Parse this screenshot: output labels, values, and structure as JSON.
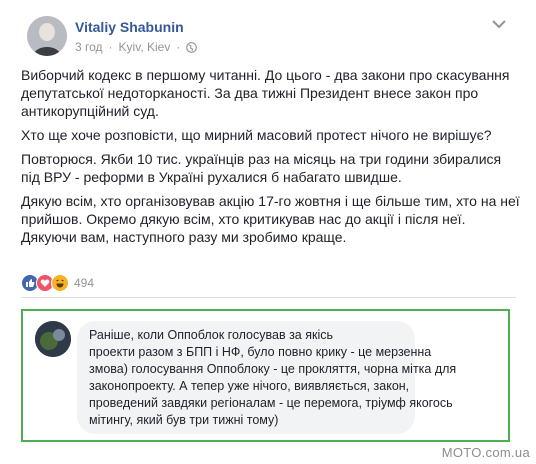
{
  "post": {
    "author": "Vitaliy Shabunin",
    "time": "3 год",
    "location": "Kyiv, Kiev",
    "separator": "·",
    "paragraphs": [
      "Виборчий кодекс в першому читанні. До цього - два закони про скасування депутатської недоторканості. За два тижні Президент внесе закон про антикорупційний суд.",
      "Хто ще хоче розповісти, що мирний масовий протест нічого не вирішує?",
      "Повторюся. Якби 10 тис. українців раз на місяць на три години збиралися під ВРУ - реформи в Україні рухалися б набагато швидше.",
      "Дякую всім, хто організовував акцію 17-го жовтня і ще більше тим, хто на неї прийшов. Окремо дякую всім, хто критикував нас до акції і після неї. Дякуючи вам, наступного разу ми зробимо краще."
    ],
    "reaction_count": "494",
    "reaction_icons": [
      "like-icon",
      "love-icon",
      "haha-icon"
    ]
  },
  "comment": {
    "lines": [
      "Раніше, коли Оппоблок голосував за якісь",
      "проекти разом з БПП і НФ, було повно крику - це мерзенна",
      "змова) голосування Оппоблоку - це прокляття, чорна мітка для",
      "законопроекту. А тепер уже нічого, виявляється, закон,",
      "проведений завдяки регіоналам - це перемога, тріумф якогось",
      "мітингу, який був три тижні тому)"
    ],
    "border_color": "#4caf50"
  },
  "watermark": "MOTO.com.ua",
  "colors": {
    "author": "#365899",
    "meta": "#90949c",
    "text": "#1d2129",
    "like": "#4267b2",
    "love": "#f25268",
    "haha": "#f7b125"
  }
}
